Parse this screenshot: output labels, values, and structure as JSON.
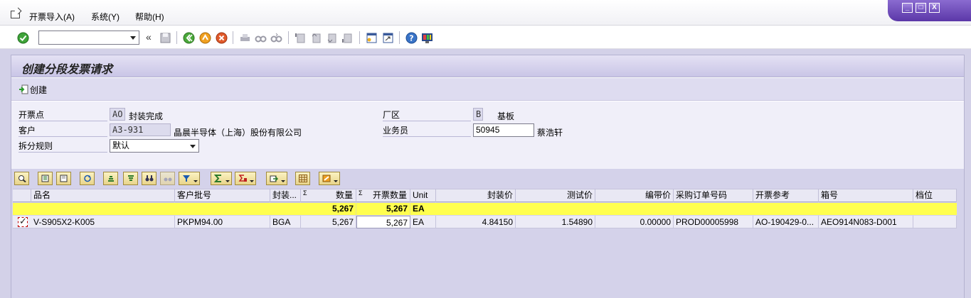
{
  "menu": {
    "items": [
      {
        "label": "开票导入(A)"
      },
      {
        "label": "系统(Y)"
      },
      {
        "label": "帮助(H)"
      }
    ]
  },
  "window_controls": {
    "minimize": "_",
    "restore": "□",
    "close": "X"
  },
  "toolbar": {
    "command_value": "",
    "icons": [
      "enter-icon",
      "command-field-dropdown",
      "collapse-icon",
      "save-icon",
      "back-icon",
      "exit-icon",
      "cancel-icon",
      "print-icon",
      "find-icon",
      "find-next-icon",
      "first-page-icon",
      "prev-page-icon",
      "next-page-icon",
      "last-page-icon",
      "new-session-icon",
      "shortcut-icon",
      "help-icon",
      "customize-layout-icon"
    ]
  },
  "page": {
    "title": "创建分段发票请求"
  },
  "appbar": {
    "create_label": "创建"
  },
  "form": {
    "invoice_point": {
      "label": "开票点",
      "code": "AO",
      "text": "封装完成"
    },
    "customer": {
      "label": "客户",
      "code": "A3-931",
      "text": "晶晨半导体（上海）股份有限公司"
    },
    "split_rule": {
      "label": "拆分规则",
      "value": "默认"
    },
    "plant_area": {
      "label": "厂区",
      "code": "B",
      "text": "基板"
    },
    "salesperson": {
      "label": "业务员",
      "value": "50945",
      "text": "蔡浩轩"
    }
  },
  "grid": {
    "columns": [
      "品名",
      "客户批号",
      "封装...",
      "Σ",
      "数量",
      "Σ",
      "开票数量",
      "Unit",
      "封装价",
      "测试价",
      "编带价",
      "采购订单号码",
      "开票参考",
      "箱号",
      "档位"
    ],
    "sum_row": {
      "qty": "5,267",
      "invoice_qty": "5,267",
      "unit": "EA"
    },
    "rows": [
      {
        "checked": true,
        "product": "V-S905X2-K005",
        "customer_lot": "PKPM94.00",
        "package": "BGA",
        "qty": "5,267",
        "invoice_qty": "5,267",
        "unit": "EA",
        "package_price": "4.84150",
        "test_price": "1.54890",
        "tape_price": "0.00000",
        "po_number": "PROD00005998",
        "invoice_ref": "AO-190429-0...",
        "box_no": "AEO914N083-D001",
        "grade": ""
      }
    ]
  },
  "colors": {
    "accent": "#6a48b8",
    "sum_row": "#ffff4f",
    "panel": "#d3d1e8"
  }
}
